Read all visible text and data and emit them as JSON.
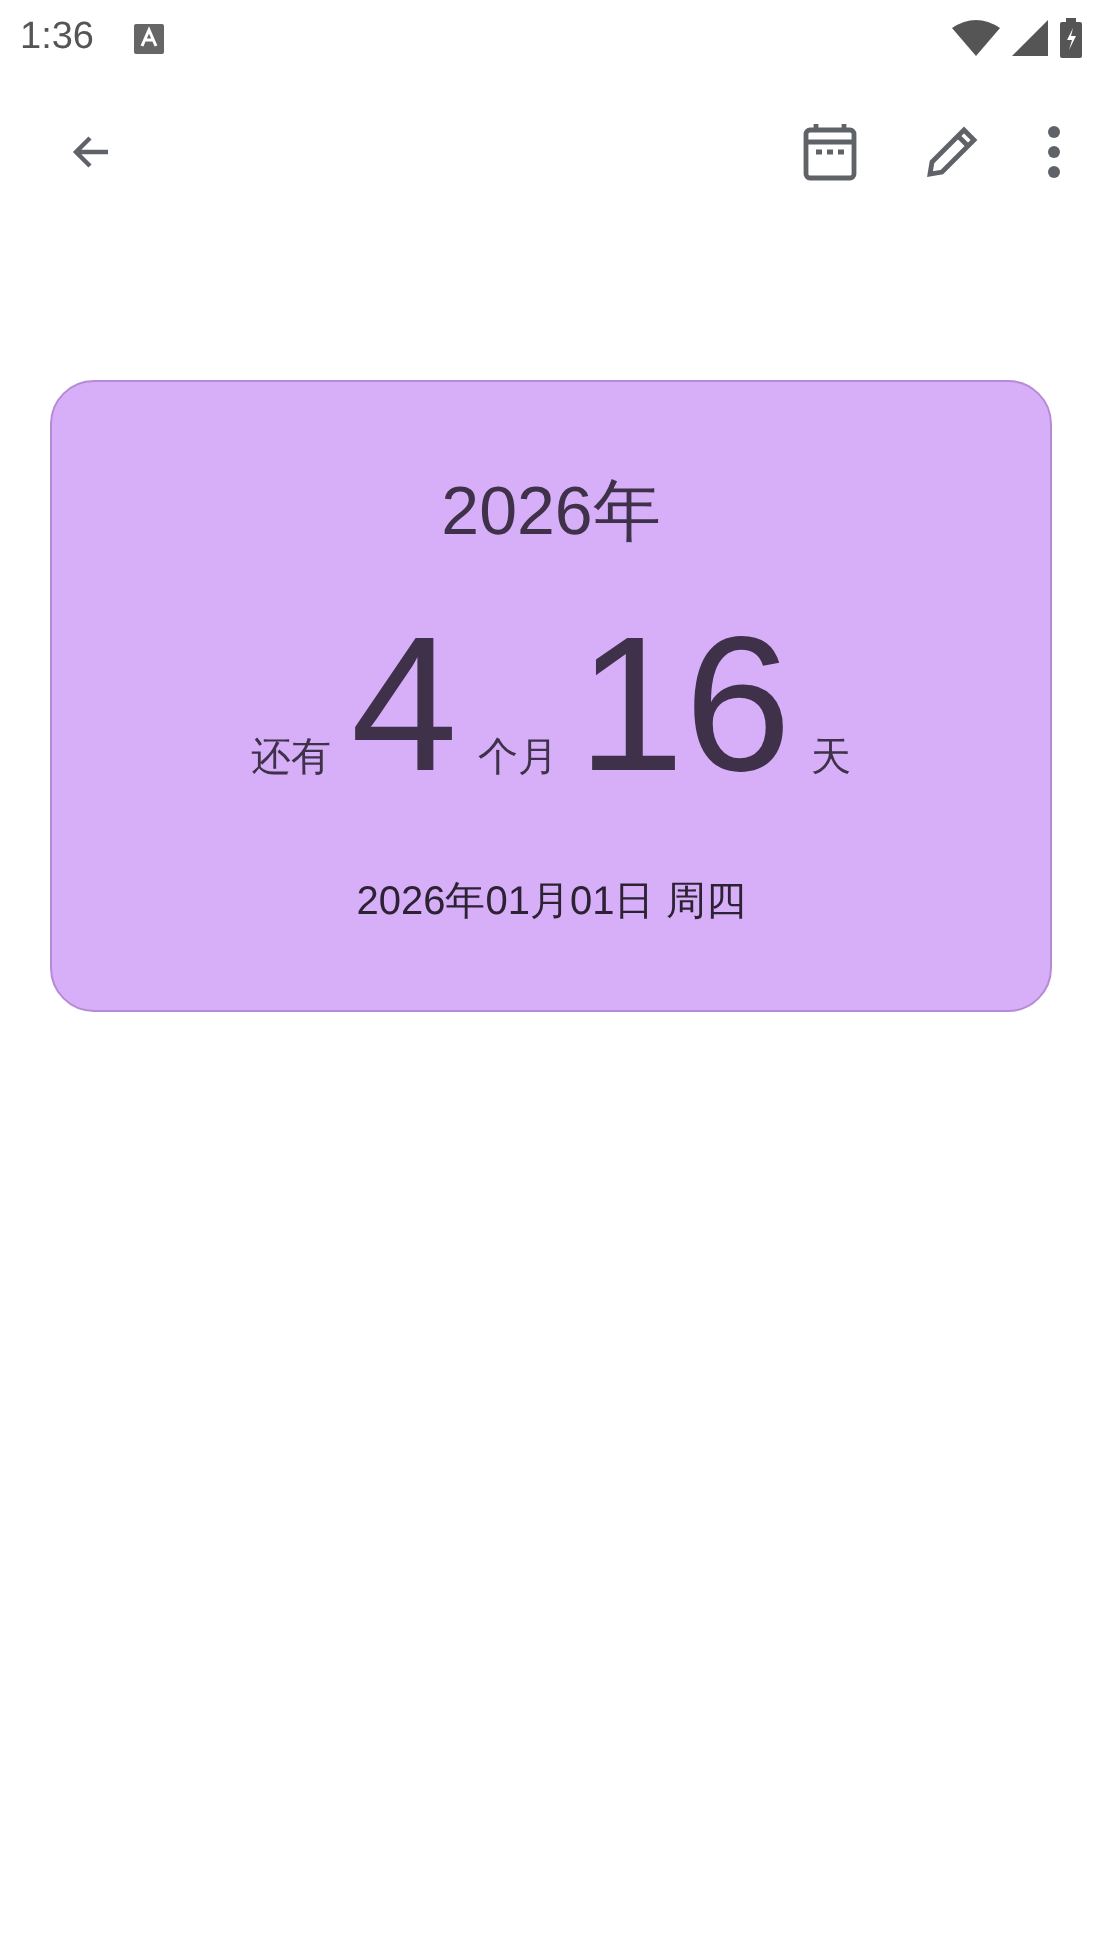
{
  "status_bar": {
    "time": "1:36"
  },
  "card": {
    "title": "2026年",
    "countdown": [
      {
        "kind": "label",
        "text": "还有"
      },
      {
        "kind": "number",
        "text": "4"
      },
      {
        "kind": "label",
        "text": "个月"
      },
      {
        "kind": "number",
        "text": "16"
      },
      {
        "kind": "label",
        "text": "天"
      }
    ],
    "date": "2026年01月01日 周四"
  }
}
